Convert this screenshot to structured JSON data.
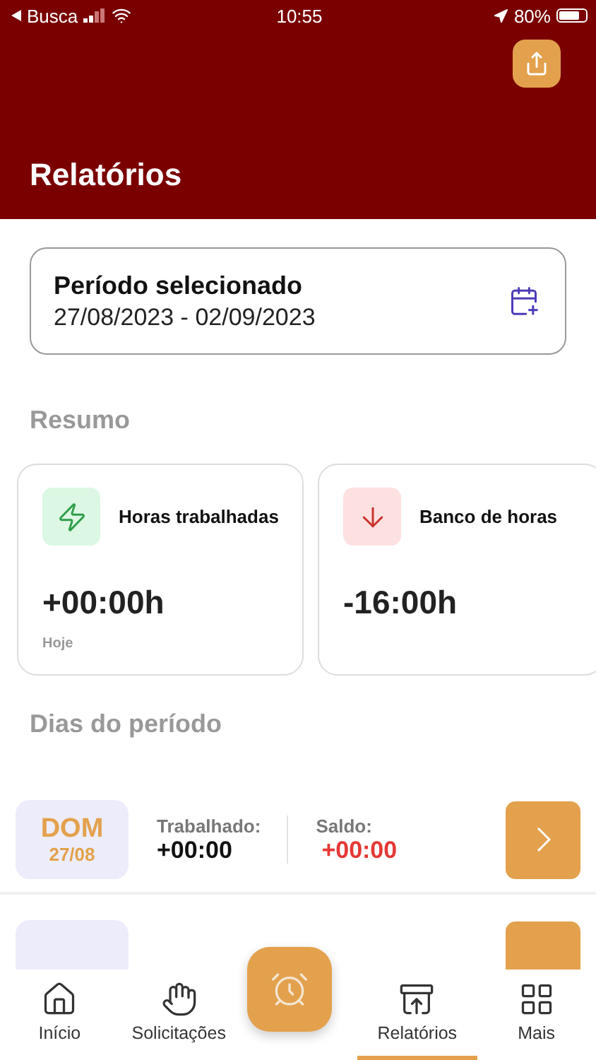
{
  "status_bar": {
    "back_label": "Busca",
    "time": "10:55",
    "battery": "80%"
  },
  "header": {
    "title": "Relatórios"
  },
  "period": {
    "label": "Período selecionado",
    "range": "27/08/2023 - 02/09/2023"
  },
  "summary": {
    "heading": "Resumo",
    "cards": [
      {
        "kind": "worked",
        "title": "Horas trabalhadas",
        "value": "+00:00h",
        "note": "Hoje"
      },
      {
        "kind": "bank",
        "title": "Banco de horas",
        "value": "-16:00h"
      }
    ]
  },
  "days": {
    "heading": "Dias do período",
    "rows": [
      {
        "day": "DOM",
        "date": "27/08",
        "worked_label": "Trabalhado:",
        "worked": "+00:00",
        "balance_label": "Saldo:",
        "balance": "+00:00"
      },
      {
        "kind": "clipped"
      }
    ]
  },
  "tab_bar": [
    {
      "kind": "home",
      "label": "Início",
      "selected": false
    },
    {
      "kind": "hand",
      "label": "Solicitações",
      "selected": false
    },
    {
      "kind": "clock",
      "selected": false
    },
    {
      "kind": "reports",
      "label": "Relatórios",
      "selected": true
    },
    {
      "kind": "more",
      "label": "Mais",
      "selected": false
    }
  ]
}
